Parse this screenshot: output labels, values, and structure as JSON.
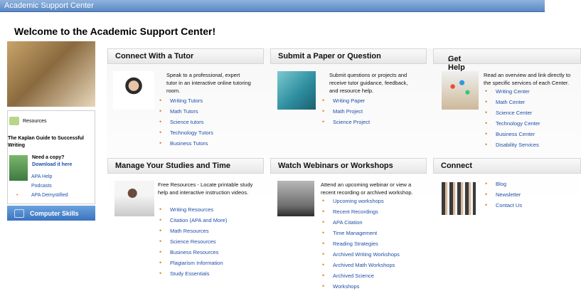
{
  "topbar": {
    "title": "Academic Support Center"
  },
  "welcome": "Welcome to the Academic Support Center!",
  "sidebar": {
    "resources_label": "Resources",
    "kaplan_title": "The Kaplan Guide to Successful Writing",
    "need_copy": "Need a copy?",
    "download": "Download it here",
    "links": [
      "APA Help",
      "Podcasts",
      "APA Demystified"
    ],
    "computer_skills": "Computer Skills"
  },
  "cards": {
    "tutor": {
      "title": "Connect With a Tutor",
      "desc": "Speak to a professional, expert tutor in an interactive online tutoring room.",
      "links": [
        "Writing Tutors",
        "Math Tutors",
        "Science tutors",
        "Technology Tutors",
        "Business Tutors"
      ]
    },
    "paper": {
      "title": "Submit a Paper or Question",
      "desc": "Submit questions or projects and receive tutor guidance, feedback, and resource help.",
      "links": [
        "Writing Paper",
        "Math Project",
        "Science Project"
      ]
    },
    "help": {
      "title": "Get Help From",
      "title_dots": ". . .",
      "desc": "Read an overview and link directly to the specific services of each Center.",
      "links": [
        "Writing Center",
        "Math Center",
        "Science Center",
        "Technology Center",
        "Business Center",
        "Disability Services"
      ]
    },
    "manage": {
      "title": "Manage Your Studies and Time",
      "desc": "Free Resources - Locate printable study help and interactive instruction videos.",
      "links": [
        "Writing Resources",
        "Citation (APA and More)",
        "Math Resources",
        "Science Resources",
        "Business Resources",
        "Plagiarism Information",
        "Study Essentials"
      ]
    },
    "webinar": {
      "title": "Watch Webinars or Workshops",
      "desc": "Attend an upcoming webinar or view a recent recording or archived workshop.",
      "links": [
        "Upcoming workshops",
        "Recent Recordings",
        "APA Citation",
        "Time Management",
        "Reading Strategies",
        "Archived Writing Workshops",
        "Archived Math Workshops",
        "Archived Science",
        "Workshops"
      ]
    },
    "connect": {
      "title": "Connect",
      "links": [
        "Blog",
        "Newsletter",
        "Contact Us"
      ]
    }
  }
}
